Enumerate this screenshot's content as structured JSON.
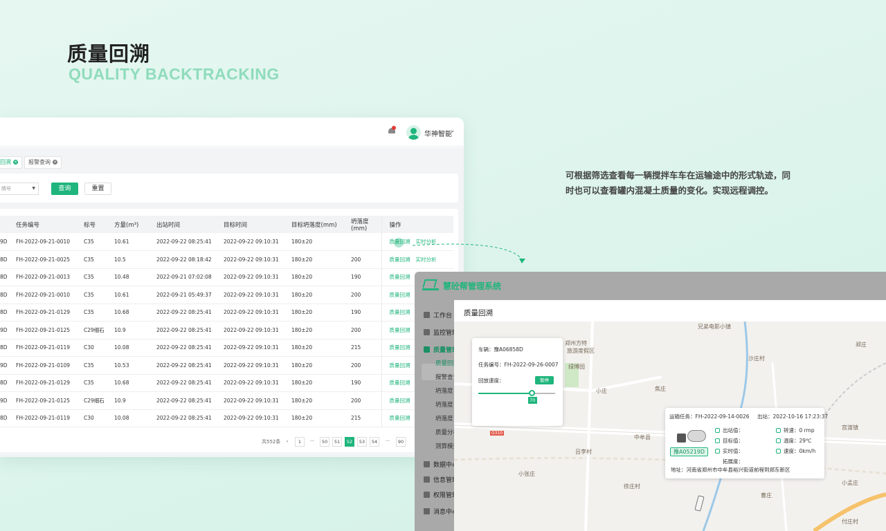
{
  "header": {
    "title": "质量回溯",
    "subtitle": "QUALITY BACKTRACKING",
    "description": "可根据筛选查看每一辆搅拌车车在运输途中的形式轨迹，同时也可以查看罐内混凝土质量的变化。实现远程调控。"
  },
  "list_screen": {
    "user": {
      "name": "华神智能"
    },
    "tabs": [
      {
        "label": "回溯",
        "active": true
      },
      {
        "label": "报警查询",
        "active": false
      }
    ],
    "filter": {
      "select_value": "牌号",
      "query_label": "查询",
      "reset_label": "重置"
    },
    "table": {
      "columns": [
        "",
        "任务编号",
        "标号",
        "方量(m³)",
        "出站时间",
        "目标时间",
        "目标坍落度(mm)",
        "坍落度(mm)",
        "操作"
      ],
      "rows": [
        [
          "9D",
          "FH-2022-09-21-0010",
          "C35",
          "10.61",
          "2022-09-22 08:25:41",
          "2022-09-22 09:10:31",
          "180±20",
          "",
          "质量回溯",
          "实时分析"
        ],
        [
          "8D",
          "FH-2022-09-21-0025",
          "C35",
          "10.5",
          "2022-09-22 08:18:42",
          "2022-09-22 09:10:31",
          "180±20",
          "200",
          "质量回溯",
          "实时分析"
        ],
        [
          "8D",
          "FH-2022-09-21-0013",
          "C35",
          "10.48",
          "2022-09-21 07:02:08",
          "2022-09-22 09:10:31",
          "180±20",
          "190",
          "质量回溯",
          ""
        ],
        [
          "8D",
          "FH-2022-09-21-0010",
          "C35",
          "10.61",
          "2022-09-21 05:49:37",
          "2022-09-22 09:10:31",
          "180±20",
          "200",
          "质量回溯",
          ""
        ],
        [
          "8D",
          "FH-2022-09-21-0129",
          "C35",
          "10.68",
          "2022-09-22 08:25:41",
          "2022-09-22 09:10:31",
          "180±20",
          "190",
          "质量回溯",
          ""
        ],
        [
          "9D",
          "FH-2022-09-21-0125",
          "C29细石",
          "10.9",
          "2022-09-22 08:25:41",
          "2022-09-22 09:10:31",
          "180±20",
          "200",
          "质量回溯",
          ""
        ],
        [
          "8D",
          "FH-2022-09-21-0119",
          "C30",
          "10.08",
          "2022-09-22 08:25:41",
          "2022-09-22 09:10:31",
          "180±20",
          "215",
          "质量回溯",
          ""
        ],
        [
          "9D",
          "FH-2022-09-21-0109",
          "C35",
          "10.53",
          "2022-09-22 08:25:41",
          "2022-09-22 09:10:31",
          "180±20",
          "200",
          "质量回溯",
          ""
        ],
        [
          "8D",
          "FH-2022-09-21-0129",
          "C35",
          "10.68",
          "2022-09-22 08:25:41",
          "2022-09-22 09:10:31",
          "180±20",
          "190",
          "质量回溯",
          ""
        ],
        [
          "9D",
          "FH-2022-09-21-0125",
          "C29细石",
          "10.9",
          "2022-09-22 08:25:41",
          "2022-09-22 09:10:31",
          "180±20",
          "200",
          "质量回溯",
          ""
        ],
        [
          "8D",
          "FH-2022-09-21-0119",
          "C30",
          "10.08",
          "2022-09-22 08:25:41",
          "2022-09-22 09:10:31",
          "180±20",
          "215",
          "质量回溯",
          ""
        ]
      ]
    },
    "pagination": {
      "total": "共552条",
      "prev": "‹",
      "pages": [
        "1",
        "···",
        "50",
        "51",
        "52",
        "53",
        "54",
        "···",
        "90"
      ],
      "current": "52"
    }
  },
  "detail_screen": {
    "system_name": "慧砼帮管理系统",
    "nav": [
      {
        "label": "工作台",
        "icon": "grid-icon"
      },
      {
        "label": "监控管理",
        "icon": "monitor-icon"
      },
      {
        "label": "质量管理",
        "icon": "quality-icon",
        "active": true
      },
      {
        "label": "数据中心",
        "icon": "data-icon"
      },
      {
        "label": "信息管理",
        "icon": "info-icon"
      },
      {
        "label": "权限管理",
        "icon": "user-icon"
      },
      {
        "label": "消息中心",
        "icon": "message-icon"
      }
    ],
    "subnav": [
      "质量回溯",
      "报警查询",
      "坍落度",
      "坍落度",
      "坍落度",
      "质量分析",
      "测算模型"
    ],
    "window_title": "质量回溯",
    "playback": {
      "vehicle_label": "车辆：",
      "vehicle": "豫A06858D",
      "task_label": "任务编号：",
      "task": "FH-2022-09-26-0007",
      "speed_label": "回放速度：",
      "pause_label": "暂停",
      "speed_value": 70
    },
    "vehicle_info": {
      "task_label": "运输任务：",
      "task": "FH-2022-09-14-0026",
      "out_label": "出站：",
      "out_time": "2022-10-16 17:23:37",
      "plate": "豫A05219D",
      "fields_left": [
        "出站值：",
        "目标值：",
        "实时值：",
        "拓展度："
      ],
      "fields_right": [
        "转速：0 rmp",
        "温度：29℃",
        "速度：0km/h"
      ],
      "address": "地址：河南省郑州市中牟县裕兴街道前程到郑东新区"
    },
    "map_labels": [
      "兄弟电影小镇",
      "郑州方特",
      "旅游度假区",
      "绿博园",
      "小庄",
      "焦庄",
      "郑庄",
      "沙庄村",
      "中牟县",
      "吕李村",
      "小张庄",
      "徐庄村",
      "曹庄",
      "付庄村",
      "宫渡镇",
      "小孟庄",
      "G310"
    ]
  },
  "colors": {
    "accent": "#1fb57c",
    "subtitle": "#8fdcbc",
    "background": "#dcf4ec"
  }
}
